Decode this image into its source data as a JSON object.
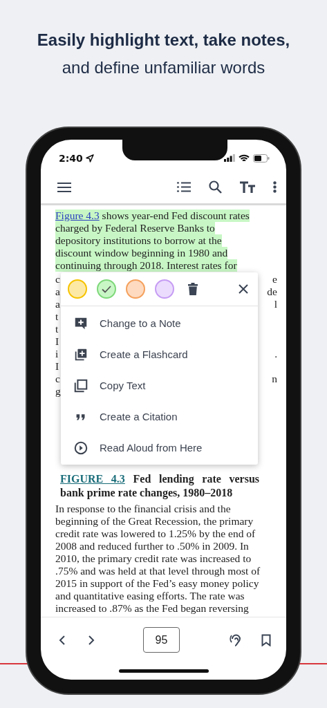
{
  "headline": {
    "title": "Easily highlight text, take notes,",
    "subtitle": "and define unfamiliar words"
  },
  "status_bar": {
    "time": "2:40"
  },
  "highlighted_paragraph": {
    "highlighted": true,
    "link": "Figure 4.3",
    "lines": [
      "shows year-end Fed discount rates",
      "charged by Federal Reserve Banks to",
      "depository institutions to borrow at the",
      "discount window beginning in 1980 and",
      "continuing through 2018. Interest rates for"
    ]
  },
  "covered_rows": [
    {
      "left": "c",
      "right": "e"
    },
    {
      "left": "a",
      "right": "de"
    },
    {
      "left": "a",
      "right": "l"
    },
    {
      "left": "t"
    },
    {
      "left": "t"
    },
    {
      "left": "I"
    },
    {
      "left": "i",
      "right": "."
    },
    {
      "left": "I"
    },
    {
      "left": "c",
      "right": "n"
    },
    {
      "left": "g"
    }
  ],
  "highlight_menu": {
    "colors": [
      {
        "color": "#fde9a6",
        "selected": false
      },
      {
        "color": "#c8f7c5",
        "selected": true
      },
      {
        "color": "#fddac0",
        "selected": false
      },
      {
        "color": "#ebdcfd",
        "selected": false
      }
    ],
    "actions": [
      {
        "kind": "note",
        "label": "Change to a Note"
      },
      {
        "kind": "flashcard",
        "label": "Create a Flashcard"
      },
      {
        "kind": "copy",
        "label": "Copy Text"
      },
      {
        "kind": "citation",
        "label": "Create a Citation"
      },
      {
        "kind": "play",
        "label": "Read Aloud from Here"
      }
    ]
  },
  "figure_caption": {
    "link": "FIGURE 4.3",
    "title": "Fed lending rate versus bank prime rate changes, 1980–2018"
  },
  "body_paragraph": {
    "lines": [
      "In response to the financial crisis and the",
      "beginning of the Great Recession, the primary",
      "credit rate was lowered to 1.25% by the end of",
      "2008 and reduced further to .50% in 2009. In",
      "2010, the primary credit rate was increased to",
      ".75% and was held at that level through most of",
      "2015 in support of the Fed’s easy money policy",
      "and quantitative easing efforts. The rate was",
      "increased to .87% as the Fed began reversing"
    ]
  },
  "bottom_bar": {
    "page": "95"
  }
}
